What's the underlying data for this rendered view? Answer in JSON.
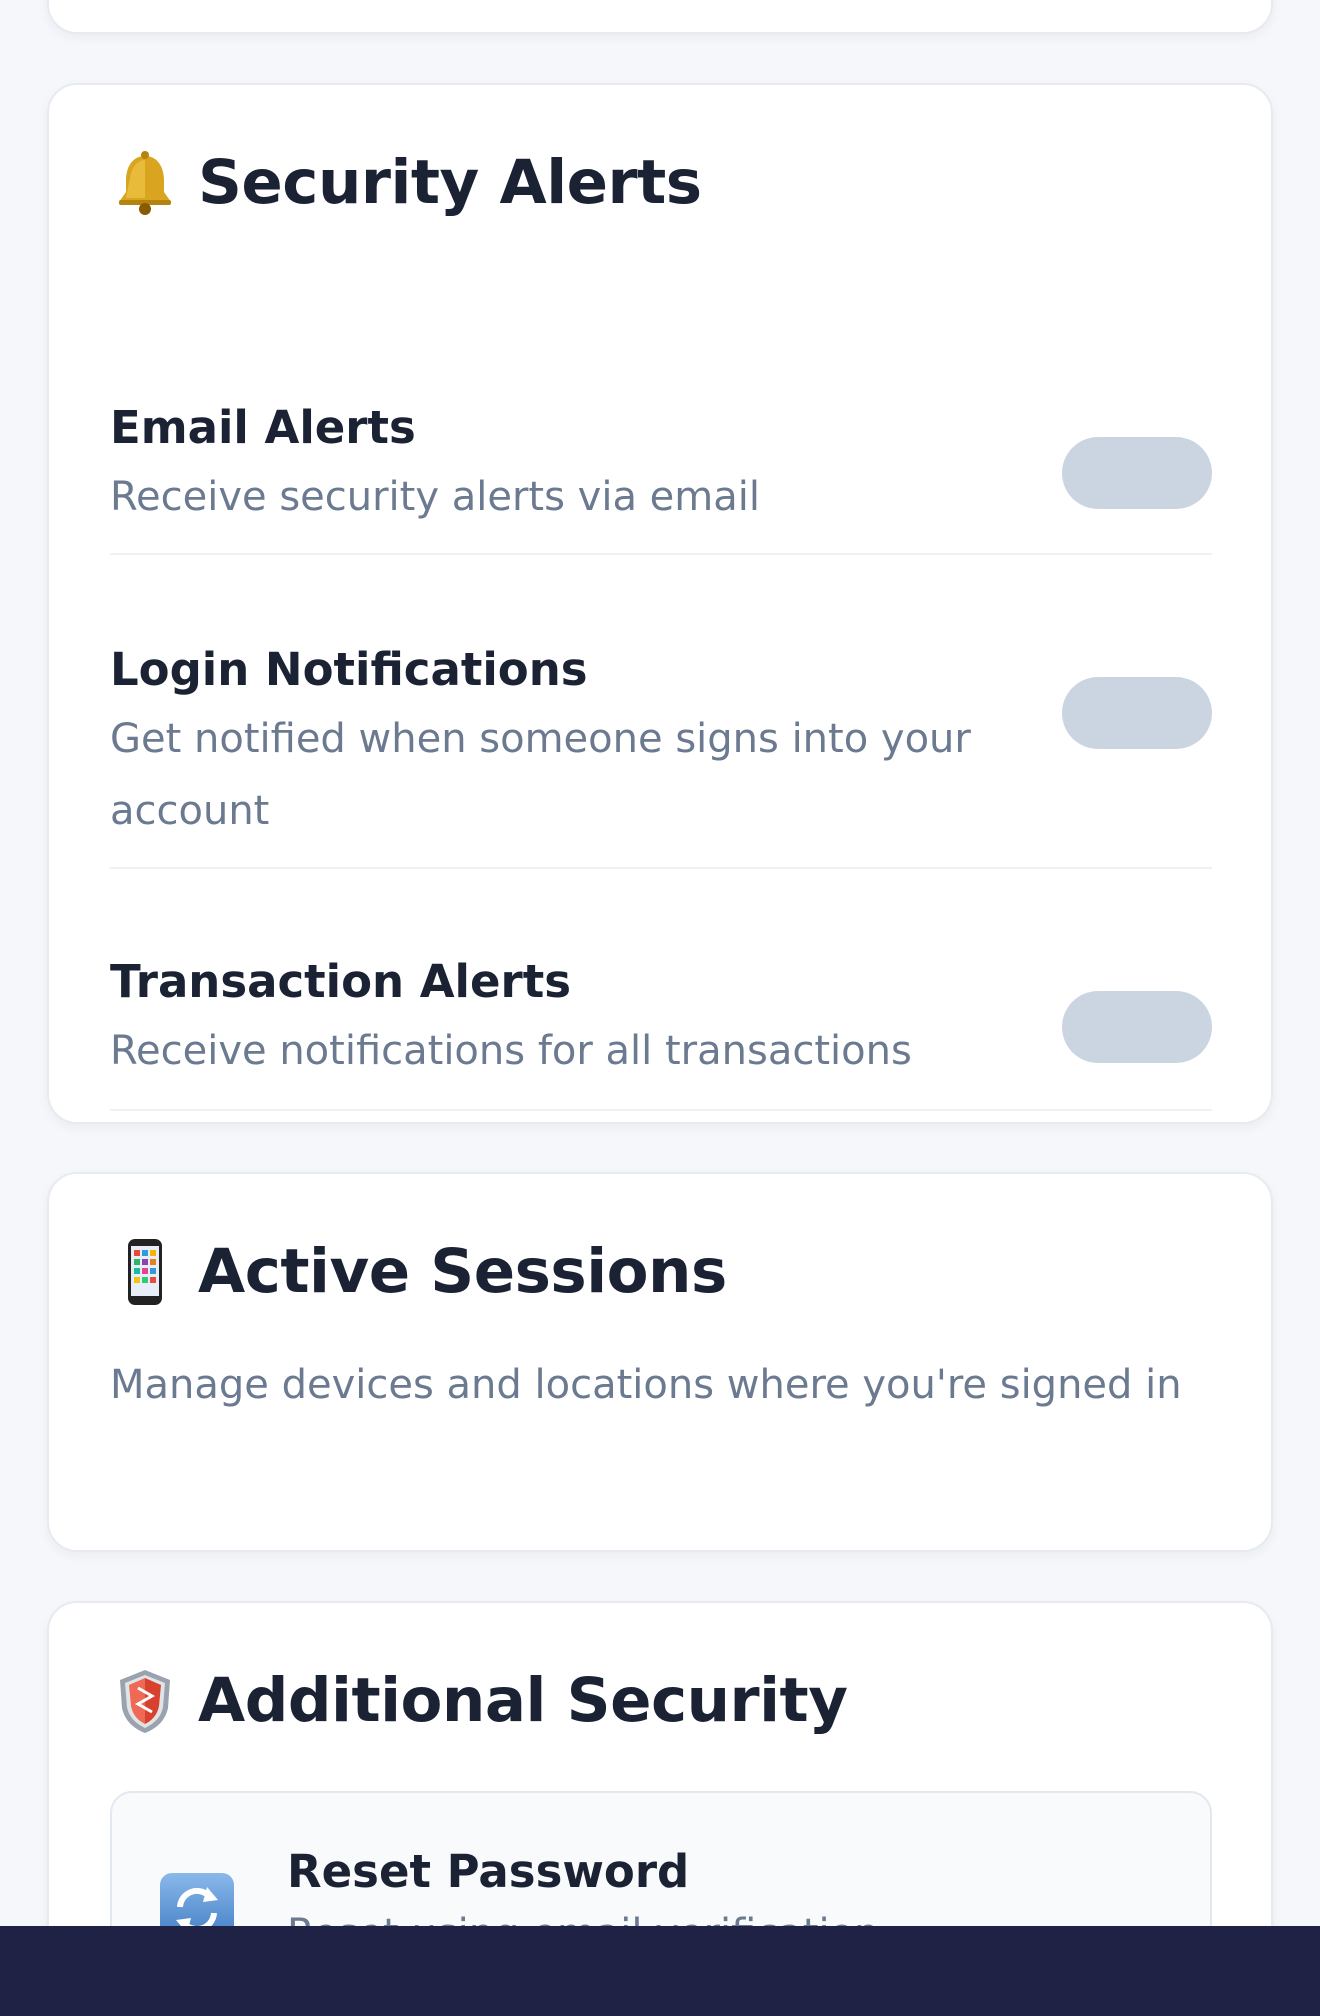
{
  "alerts_card": {
    "title": "Security Alerts",
    "icon": "bell-icon",
    "settings": [
      {
        "label": "Email Alerts",
        "description": "Receive security alerts via email",
        "enabled": false
      },
      {
        "label": "Login Notifications",
        "description": "Get notified when someone signs into your account",
        "enabled": false
      },
      {
        "label": "Transaction Alerts",
        "description": "Receive notifications for all transactions",
        "enabled": false
      }
    ]
  },
  "sessions_card": {
    "title": "Active Sessions",
    "icon": "mobile-phone-icon",
    "description": "Manage devices and locations where you're signed in"
  },
  "additional_card": {
    "title": "Additional Security",
    "icon": "shield-icon",
    "actions": [
      {
        "title": "Reset Password",
        "icon": "refresh-icon",
        "description": "Reset using email verification"
      }
    ]
  },
  "colors": {
    "toggle_off": "#cbd5e1",
    "text_primary": "#1a2233",
    "text_secondary": "#6b7a90",
    "bottom_bar": "#1f2145"
  }
}
